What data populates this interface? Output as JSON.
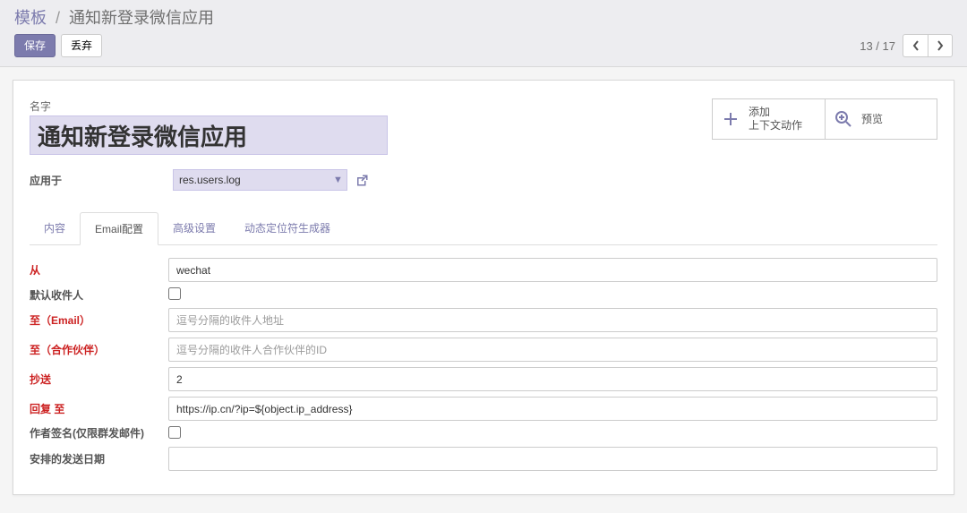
{
  "breadcrumb": {
    "root": "模板",
    "current": "通知新登录微信应用"
  },
  "buttons": {
    "save": "保存",
    "discard": "丢弃"
  },
  "pager": {
    "text": "13 / 17"
  },
  "title_field": {
    "label": "名字",
    "value": "通知新登录微信应用"
  },
  "stat": {
    "add_ctx_l1": "添加",
    "add_ctx_l2": "上下文动作",
    "preview": "预览"
  },
  "applies": {
    "label": "应用于",
    "value": "res.users.log"
  },
  "tabs": {
    "content": "内容",
    "email": "Email配置",
    "advanced": "高级设置",
    "dyn": "动态定位符生成器"
  },
  "form": {
    "from_label": "从",
    "from_value": "wechat",
    "default_to_label": "默认收件人",
    "to_email_label": "至（Email）",
    "to_email_ph": "逗号分隔的收件人地址",
    "to_partner_label": "至（合作伙伴）",
    "to_partner_ph": "逗号分隔的收件人合作伙伴的ID",
    "cc_label": "抄送",
    "cc_value": "2",
    "reply_label": "回复 至",
    "reply_value": "https://ip.cn/?ip=${object.ip_address}",
    "sig_label": "作者签名(仅限群发邮件)",
    "sched_label": "安排的发送日期"
  }
}
